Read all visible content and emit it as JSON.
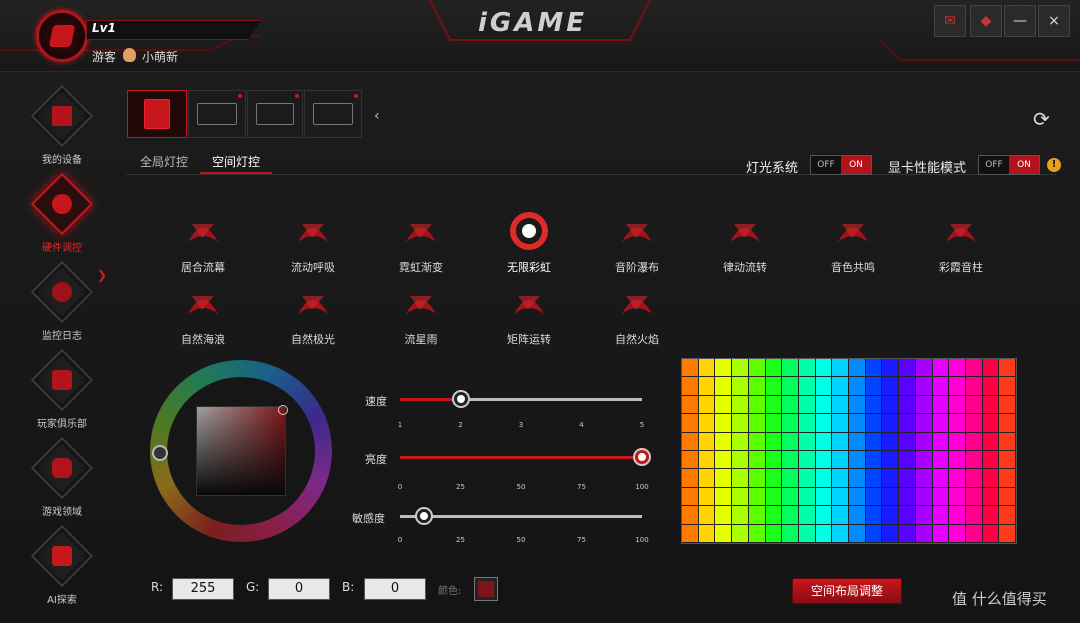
{
  "user": {
    "level": "Lv1",
    "guest_label": "游客",
    "nickname": "小萌新"
  },
  "brand": {
    "logo": "iGAME"
  },
  "window_controls": [
    {
      "icon": "mail-icon",
      "glyph": "✉"
    },
    {
      "icon": "skin-icon",
      "glyph": "◆"
    },
    {
      "icon": "minimize-icon",
      "glyph": "—"
    },
    {
      "icon": "close-icon",
      "glyph": "×"
    }
  ],
  "sidebar": {
    "items": [
      {
        "label": "我的设备",
        "icon": "monitor-icon"
      },
      {
        "label": "硬件调控",
        "icon": "control-icon",
        "active": true
      },
      {
        "label": "监控日志",
        "icon": "speed-icon"
      },
      {
        "label": "玩家俱乐部",
        "icon": "club-icon"
      },
      {
        "label": "游戏领域",
        "icon": "gamepad-icon"
      },
      {
        "label": "AI探索",
        "icon": "ai-icon"
      }
    ]
  },
  "devices": [
    {
      "icon": "liquid-cooler-icon",
      "active": true
    },
    {
      "icon": "graphics-card-icon"
    },
    {
      "icon": "motherboard-icon"
    },
    {
      "icon": "memory-icon"
    }
  ],
  "sub_tabs": [
    "全局灯控",
    "空间灯控"
  ],
  "active_sub_tab": "空间灯控",
  "toggles": [
    {
      "label": "灯光系统",
      "off": "OFF",
      "on": "ON",
      "state": "on"
    },
    {
      "label": "显卡性能模式",
      "off": "OFF",
      "on": "ON",
      "state": "on"
    }
  ],
  "effects": [
    "居合流幕",
    "流动呼吸",
    "霓虹渐变",
    "无限彩虹",
    "音阶瀑布",
    "律动流转",
    "音色共鸣",
    "彩霞音柱",
    "自然海浪",
    "自然极光",
    "流星雨",
    "矩阵运转",
    "自然火焰"
  ],
  "active_effect": "无限彩虹",
  "sliders": [
    {
      "label": "速度",
      "ticks": [
        "1",
        "2",
        "3",
        "4",
        "5"
      ],
      "value": 2,
      "min": 1,
      "max": 5
    },
    {
      "label": "亮度",
      "ticks": [
        "0",
        "25",
        "50",
        "75",
        "100"
      ],
      "value": 100,
      "min": 0,
      "max": 100
    },
    {
      "label": "敏感度",
      "ticks": [
        "0",
        "25",
        "50",
        "75",
        "100"
      ],
      "value": 10,
      "min": 0,
      "max": 100
    }
  ],
  "rgb": {
    "r_label": "R:",
    "r": "255",
    "g_label": "G:",
    "g": "0",
    "b_label": "B:",
    "b": "0",
    "color_label": "颜色:",
    "color": "#7c1518"
  },
  "layout_button": "空间布局调整",
  "watermark": "值 什么值得买",
  "grid_colors": [
    "#ff7a00",
    "#ffd400",
    "#e6ff00",
    "#a8ff00",
    "#5cff00",
    "#1aff1a",
    "#00ff5c",
    "#00ffa8",
    "#00ffe6",
    "#00d4ff",
    "#008cff",
    "#0044ff",
    "#1a1aff",
    "#5c00ff",
    "#a800ff",
    "#e600ff",
    "#ff00d4",
    "#ff008c",
    "#ff0044",
    "#ff3a1a"
  ]
}
